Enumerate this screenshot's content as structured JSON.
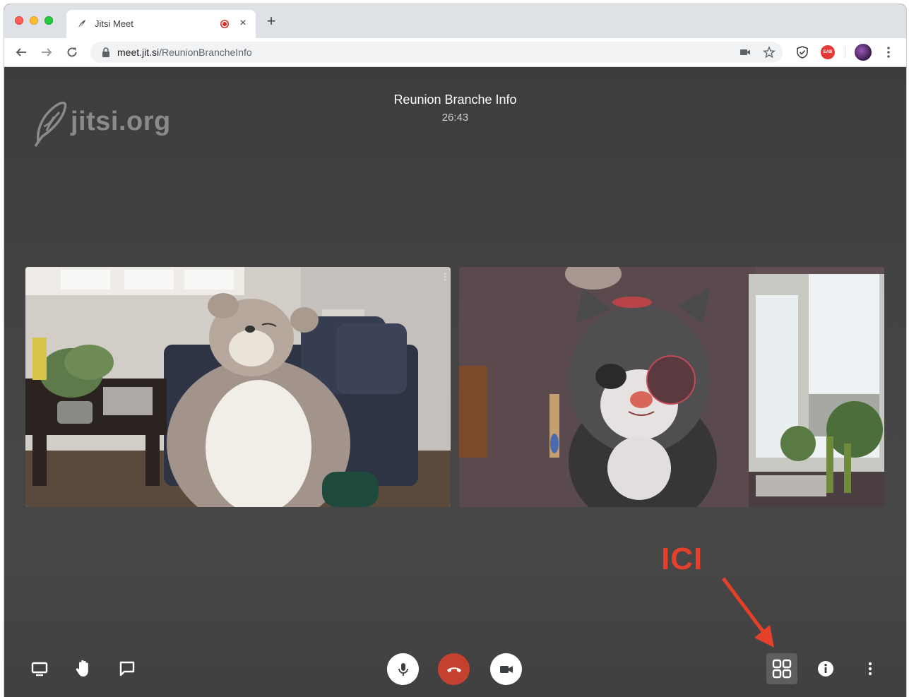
{
  "browser": {
    "tab": {
      "title": "Jitsi Meet",
      "favicon": "jitsi-feather-icon",
      "recording_indicator": "recording-dot-icon",
      "close": "×"
    },
    "new_tab": "+",
    "url": {
      "domain": "meet.jit.si",
      "path": "/ReunionBrancheInfo"
    },
    "extension_badge": "EAB",
    "colors": {
      "tabstrip": "#dee1e6",
      "omnibox": "#f1f3f4",
      "record": "#d93025"
    }
  },
  "meeting": {
    "logo_text": "jitsi.org",
    "title": "Reunion Branche Info",
    "timer": "26:43",
    "participants": [
      {
        "scene": "plush-bear-in-living-room"
      },
      {
        "scene": "plush-cat-near-window"
      }
    ]
  },
  "annotation": {
    "label": "ICI",
    "color": "#e4402a"
  },
  "toolbar": {
    "left": [
      "screen-share-icon",
      "raise-hand-icon",
      "chat-icon"
    ],
    "center": [
      "microphone-icon",
      "hangup-icon",
      "camera-icon"
    ],
    "right": [
      "tile-view-icon",
      "info-icon",
      "more-vertical-icon"
    ],
    "colors": {
      "hangup": "#c3412e",
      "tile_active_bg": "#5e5e5e"
    }
  }
}
